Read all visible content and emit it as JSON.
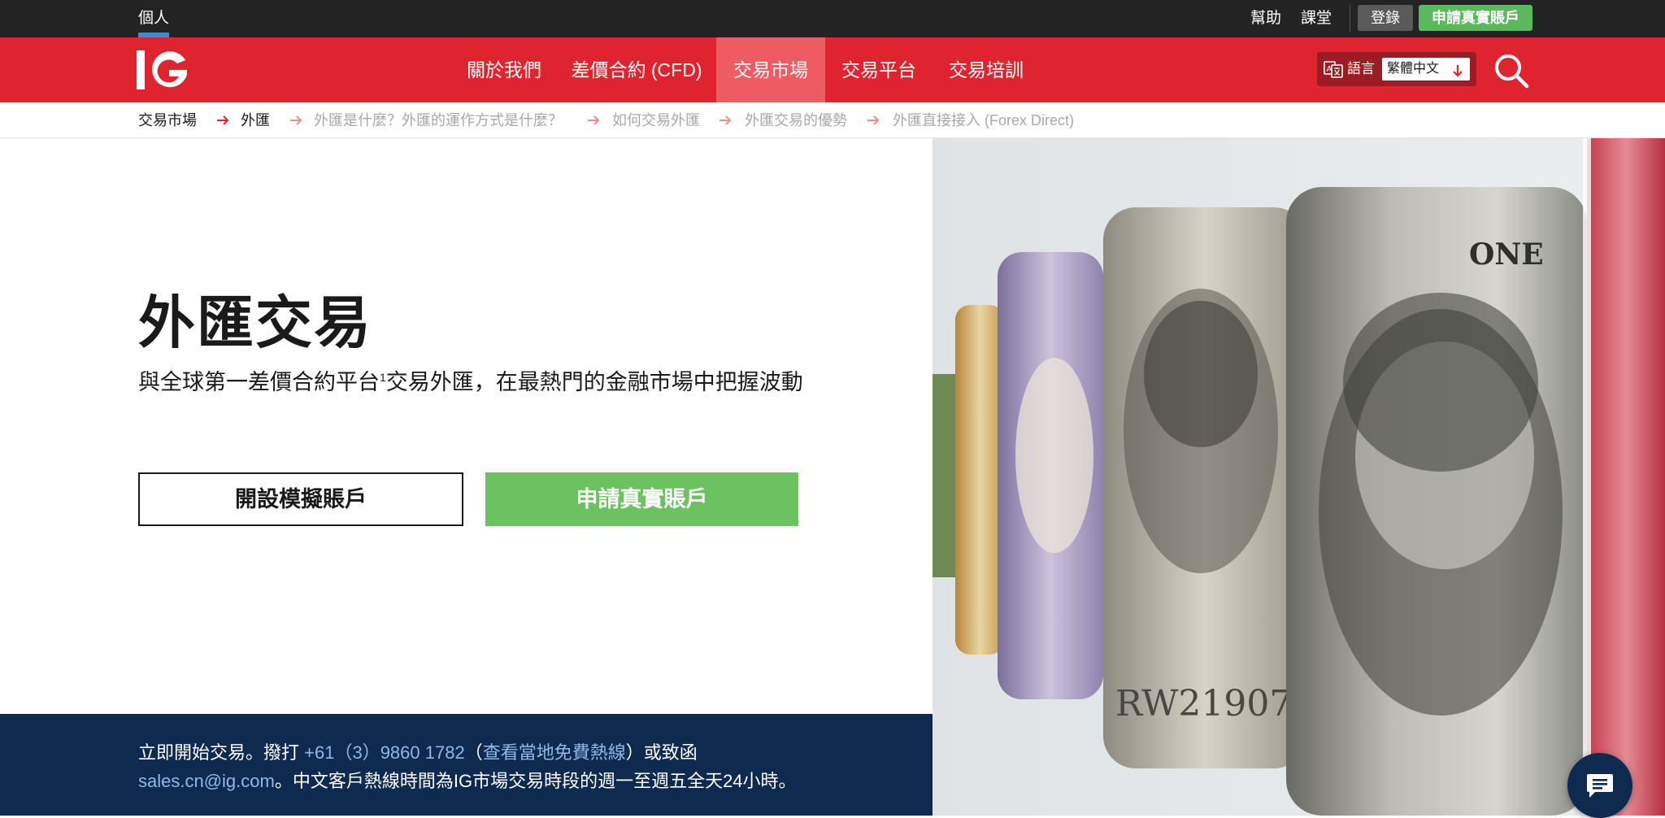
{
  "topbar": {
    "personal": "個人",
    "help": "幫助",
    "academy": "課堂",
    "login": "登錄",
    "apply": "申請真實賬戶"
  },
  "nav": {
    "logo": "IG",
    "items": [
      {
        "label": "關於我們"
      },
      {
        "label": "差價合約 (CFD)"
      },
      {
        "label": "交易市場"
      },
      {
        "label": "交易平台"
      },
      {
        "label": "交易培訓"
      }
    ],
    "active_index": 2,
    "language_label": "語言",
    "language_value": "繁體中文",
    "brand_red": "#e0242f",
    "active_red": "#ee5b62"
  },
  "breadcrumb": {
    "items": [
      {
        "label": "交易市場"
      },
      {
        "label": "外匯"
      },
      {
        "label": "外匯是什麼？外匯的運作方式是什麼？"
      },
      {
        "label": "如何交易外匯"
      },
      {
        "label": "外匯交易的優勢"
      },
      {
        "label": "外匯直接接入 (Forex Direct)"
      }
    ]
  },
  "hero": {
    "title": "外匯交易",
    "subtitle_before": "與全球第一差價合約平台",
    "subtitle_sup": "1",
    "subtitle_after": "交易外匯，在最熱門的金融市場中把握波動",
    "demo_button": "開設模擬賬戶",
    "live_button": "申請真實賬戶",
    "accent_green": "#6cc160"
  },
  "contact": {
    "line1_a": "立即開始交易。撥打",
    "phone": "+61（3）9860 1782",
    "line1_b": "（",
    "local_hotline": "查看當地免費熱線",
    "line1_c": "）或致函",
    "email": "sales.cn@ig.com",
    "line2": "。中文客戶熱線時間為IG市場交易時段的週一至週五全天24小時。",
    "bg_color": "#0f2a4f"
  },
  "hero_image": {
    "banknote_serial": "RW219078V",
    "banknote_text": "ONE"
  }
}
